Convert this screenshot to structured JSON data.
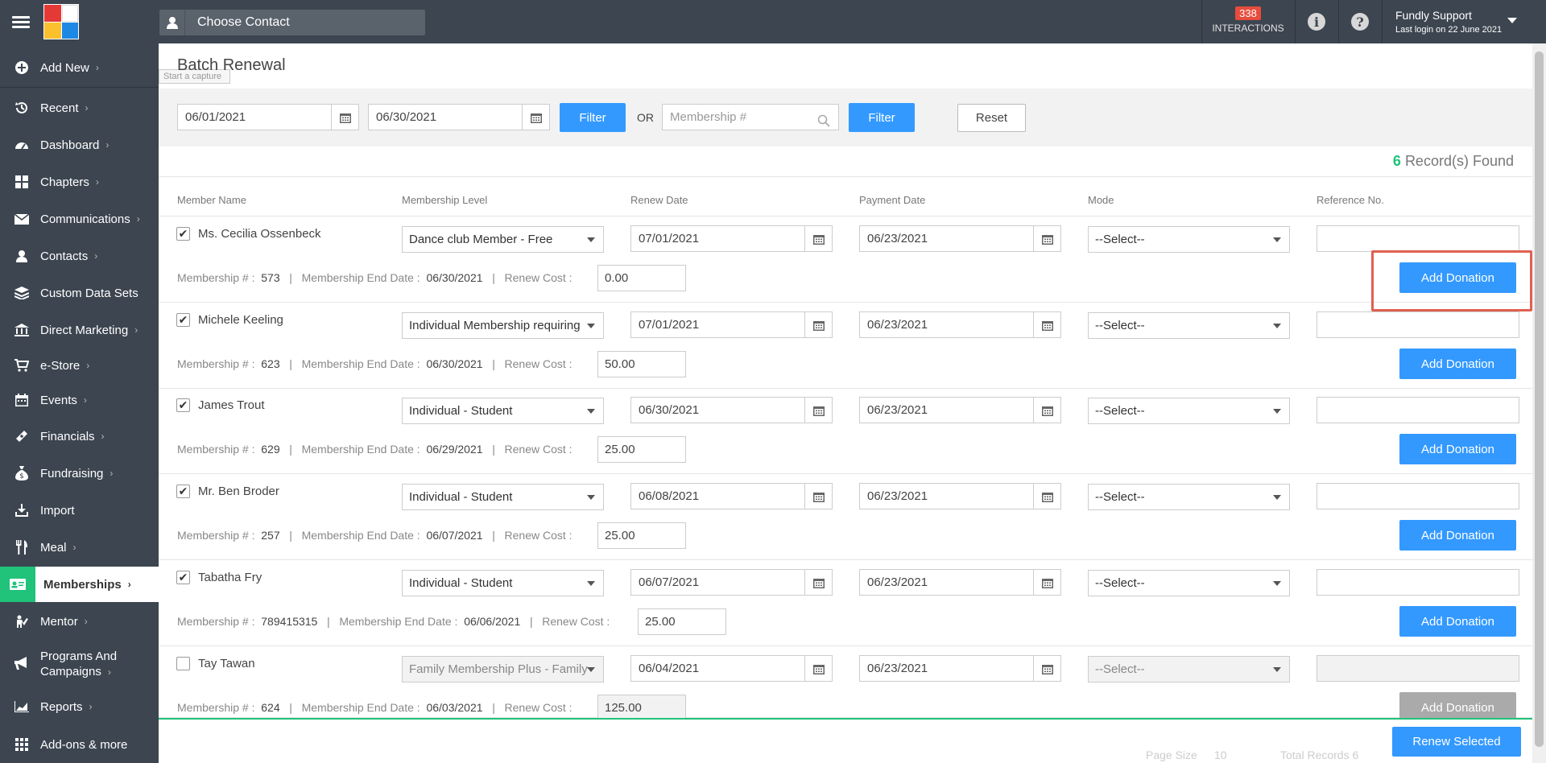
{
  "topbar": {
    "contact_label": "Choose Contact",
    "interactions_count": "338",
    "interactions_label": "INTERACTIONS",
    "info_glyph": "i",
    "help_glyph": "?",
    "user_name": "Fundly Support",
    "last_login": "Last login on 22 June 2021",
    "logo_colors": [
      "#e53935",
      "#ffffff",
      "#fbc02d",
      "#1e88e5"
    ]
  },
  "tooltip": "Start a capture",
  "sidebar": {
    "items": [
      {
        "label": "Add New",
        "icon": "plus-circle-icon"
      },
      {
        "label": "Recent",
        "icon": "history-icon"
      },
      {
        "label": "Dashboard",
        "icon": "dashboard-icon"
      },
      {
        "label": "Chapters",
        "icon": "grid-icon"
      },
      {
        "label": "Communications",
        "icon": "envelope-icon"
      },
      {
        "label": "Contacts",
        "icon": "user-icon"
      },
      {
        "label": "Custom Data Sets",
        "icon": "layers-icon"
      },
      {
        "label": "Direct Marketing",
        "icon": "bank-icon"
      },
      {
        "label": "e-Store",
        "icon": "cart-icon"
      },
      {
        "label": "Events",
        "icon": "calendar-icon"
      },
      {
        "label": "Financials",
        "icon": "money-icon"
      },
      {
        "label": "Fundraising",
        "icon": "money-bag-icon"
      },
      {
        "label": "Import",
        "icon": "download-icon"
      },
      {
        "label": "Meal",
        "icon": "cutlery-icon"
      },
      {
        "label": "Memberships",
        "icon": "id-card-icon"
      },
      {
        "label": "Mentor",
        "icon": "mentor-icon"
      },
      {
        "label": "Programs And",
        "label2": "Campaigns",
        "icon": "bullhorn-icon"
      },
      {
        "label": "Reports",
        "icon": "chart-icon"
      },
      {
        "label": "Add-ons & more",
        "icon": "apps-icon"
      }
    ],
    "active": "Memberships"
  },
  "page": {
    "title": "Batch Renewal",
    "filter": {
      "from_date": "06/01/2021",
      "to_date": "06/30/2021",
      "filter_label": "Filter",
      "or_label": "OR",
      "membership_placeholder": "Membership #",
      "filter2_label": "Filter",
      "reset_label": "Reset"
    },
    "records_count": "6",
    "records_label": "Record(s) Found",
    "columns": {
      "member_name": "Member Name",
      "membership_level": "Membership Level",
      "renew_date": "Renew Date",
      "payment_date": "Payment Date",
      "mode": "Mode",
      "reference": "Reference No."
    },
    "labels": {
      "membership_no": "Membership # :",
      "end_date": "Membership End Date :",
      "renew_cost": "Renew Cost :",
      "sep": "|",
      "add_donation": "Add Donation",
      "mode_select": "--Select--"
    },
    "rows": [
      {
        "checked": true,
        "name": "Ms. Cecilia Ossenbeck",
        "level": "Dance club Member - Free",
        "renew_date": "07/01/2021",
        "payment_date": "06/23/2021",
        "membership_no": "573",
        "end_date": "06/30/2021",
        "cost": "0.00",
        "disabled": false
      },
      {
        "checked": true,
        "name": "Michele Keeling",
        "level": "Individual Membership requiring",
        "renew_date": "07/01/2021",
        "payment_date": "06/23/2021",
        "membership_no": "623",
        "end_date": "06/30/2021",
        "cost": "50.00",
        "disabled": false
      },
      {
        "checked": true,
        "name": "James Trout",
        "level": "Individual - Student",
        "renew_date": "06/30/2021",
        "payment_date": "06/23/2021",
        "membership_no": "629",
        "end_date": "06/29/2021",
        "cost": "25.00",
        "disabled": false
      },
      {
        "checked": true,
        "name": "Mr. Ben Broder",
        "level": "Individual - Student",
        "renew_date": "06/08/2021",
        "payment_date": "06/23/2021",
        "membership_no": "257",
        "end_date": "06/07/2021",
        "cost": "25.00",
        "disabled": false
      },
      {
        "checked": true,
        "name": "Tabatha Fry",
        "level": "Individual - Student",
        "renew_date": "06/07/2021",
        "payment_date": "06/23/2021",
        "membership_no": "789415315",
        "end_date": "06/06/2021",
        "cost": "25.00",
        "disabled": false
      },
      {
        "checked": false,
        "name": "Tay Tawan",
        "level": "Family Membership Plus - Family",
        "renew_date": "06/04/2021",
        "payment_date": "06/23/2021",
        "membership_no": "624",
        "end_date": "06/03/2021",
        "cost": "125.00",
        "disabled": true
      }
    ],
    "renew_selected": "Renew Selected",
    "pager": {
      "page_size_label": "Page Size",
      "page_size_value": "10",
      "total_records": "Total Records 6"
    }
  }
}
